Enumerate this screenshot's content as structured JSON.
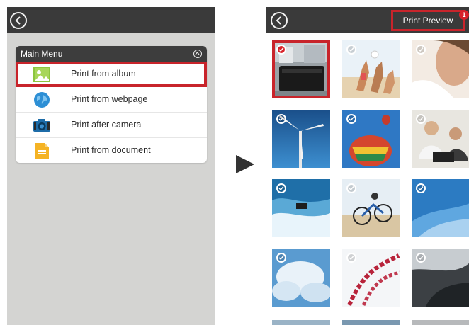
{
  "left": {
    "main_menu_title": "Main Menu",
    "items": [
      {
        "label": "Print from album",
        "icon": "album-icon",
        "highlighted": true
      },
      {
        "label": "Print from webpage",
        "icon": "globe-icon",
        "highlighted": false
      },
      {
        "label": "Print after camera",
        "icon": "camera-icon",
        "highlighted": false
      },
      {
        "label": "Print from document",
        "icon": "document-icon",
        "highlighted": false
      }
    ]
  },
  "right": {
    "print_preview_label": "Print Preview",
    "selected_count": "1",
    "photos": [
      {
        "subject": "printer",
        "selected": true
      },
      {
        "subject": "beach-volleyball",
        "selected": false
      },
      {
        "subject": "woman-portrait",
        "selected": false
      },
      {
        "subject": "wind-turbine",
        "selected": false
      },
      {
        "subject": "hot-air-balloon",
        "selected": false
      },
      {
        "subject": "business-meeting",
        "selected": false
      },
      {
        "subject": "jet-ski",
        "selected": false
      },
      {
        "subject": "mountain-bike",
        "selected": false
      },
      {
        "subject": "blue-sky",
        "selected": false
      },
      {
        "subject": "clouds",
        "selected": false
      },
      {
        "subject": "roller-coaster",
        "selected": false
      },
      {
        "subject": "cityscape",
        "selected": false
      }
    ]
  },
  "colors": {
    "accent_red": "#c8242b",
    "topbar": "#3a3a3a",
    "left_background": "#d4d4d2"
  }
}
